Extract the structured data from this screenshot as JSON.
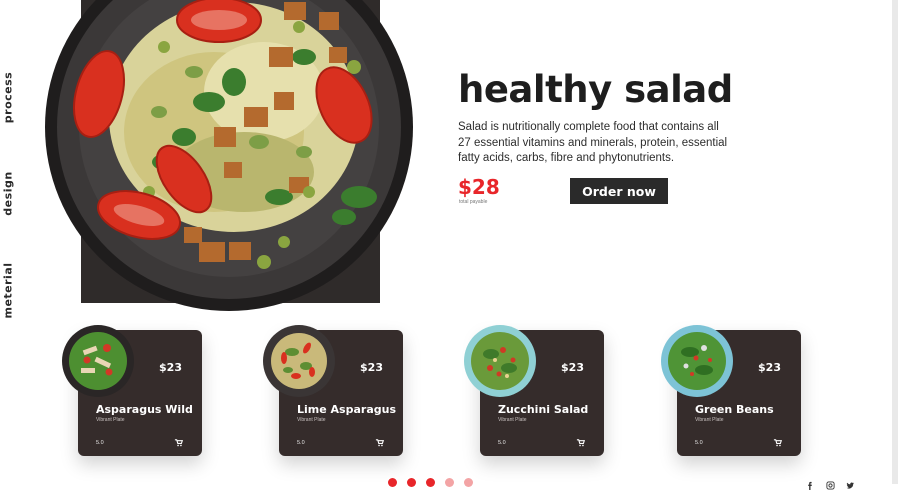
{
  "side_nav": {
    "items": [
      "process",
      "design",
      "meterial"
    ]
  },
  "hero": {
    "title": "healthy salad",
    "description": "Salad is nutritionally complete food that contains all 27 essential vitamins and minerals, protein, essential fatty acids, carbs, fibre and phytonutrients.",
    "price": "$28",
    "price_note": "total payable",
    "order_label": "Order now"
  },
  "cards": [
    {
      "name": "Asparagus Wild",
      "sub": "Vibrant Plate",
      "price": "$23",
      "rating": "5.0",
      "plate_color": "#2a2626"
    },
    {
      "name": "Lime Asparagus",
      "sub": "Vibrant Plate",
      "price": "$23",
      "rating": "5.0",
      "plate_color": "#3a3535"
    },
    {
      "name": "Zucchini Salad",
      "sub": "Vibrant Plate",
      "price": "$23",
      "rating": "5.0",
      "plate_color": "#8fd0d4"
    },
    {
      "name": "Green Beans",
      "sub": "Vibrant Plate",
      "price": "$23",
      "rating": "5.0",
      "plate_color": "#7dc3d6"
    }
  ],
  "pagination": {
    "active_index": 0,
    "count": 5
  },
  "social": [
    "facebook-icon",
    "instagram-icon",
    "twitter-icon"
  ],
  "colors": {
    "accent": "#e8262a",
    "card_bg": "#352c2b",
    "hero_bg": "#2f2b2a",
    "button_bg": "#2a2a2a"
  }
}
